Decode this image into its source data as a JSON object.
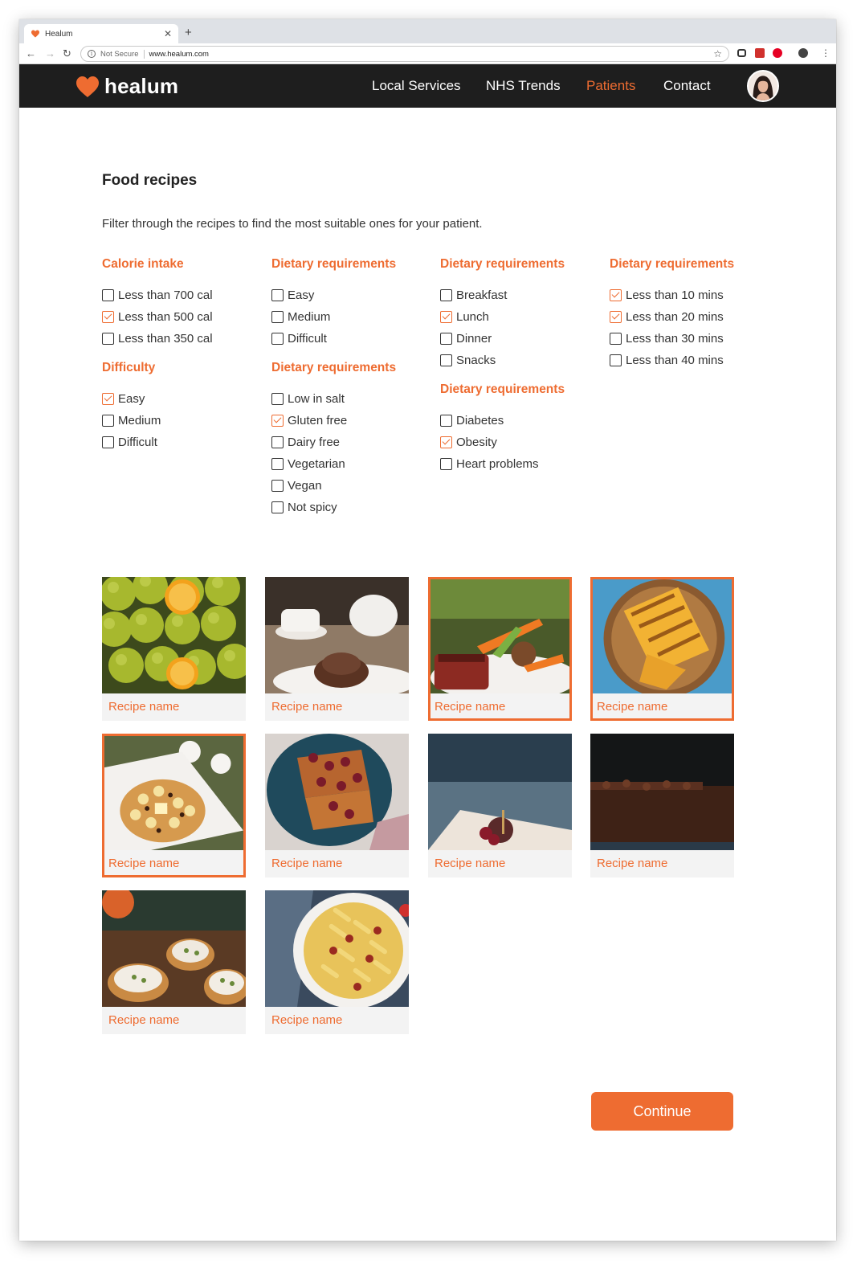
{
  "browser": {
    "tab_title": "Healum",
    "not_secure": "Not Secure",
    "url": "www.healum.com"
  },
  "site": {
    "brand": "healum",
    "nav": [
      "Local Services",
      "NHS Trends",
      "Patients",
      "Contact"
    ],
    "active_nav": "Patients"
  },
  "page": {
    "title": "Food recipes",
    "description": "Filter through the recipes to find the most suitable ones for your patient."
  },
  "filters": {
    "col1": [
      {
        "title": "Calorie intake",
        "options": [
          {
            "label": "Less than 700 cal",
            "checked": false
          },
          {
            "label": "Less than 500 cal",
            "checked": true
          },
          {
            "label": "Less than 350 cal",
            "checked": false
          }
        ]
      },
      {
        "title": "Difficulty",
        "options": [
          {
            "label": "Easy",
            "checked": true
          },
          {
            "label": "Medium",
            "checked": false
          },
          {
            "label": "Difficult",
            "checked": false
          }
        ]
      }
    ],
    "col2": [
      {
        "title": "Dietary requirements",
        "options": [
          {
            "label": "Easy",
            "checked": false
          },
          {
            "label": "Medium",
            "checked": false
          },
          {
            "label": "Difficult",
            "checked": false
          }
        ]
      },
      {
        "title": "Dietary requirements",
        "options": [
          {
            "label": "Low in salt",
            "checked": false
          },
          {
            "label": "Gluten free",
            "checked": true
          },
          {
            "label": "Dairy free",
            "checked": false
          },
          {
            "label": "Vegetarian",
            "checked": false
          },
          {
            "label": "Vegan",
            "checked": false
          },
          {
            "label": "Not spicy",
            "checked": false
          }
        ]
      }
    ],
    "col3": [
      {
        "title": "Dietary requirements",
        "options": [
          {
            "label": "Breakfast",
            "checked": false
          },
          {
            "label": "Lunch",
            "checked": true
          },
          {
            "label": "Dinner",
            "checked": false
          },
          {
            "label": "Snacks",
            "checked": false
          }
        ]
      },
      {
        "title": "Dietary requirements",
        "options": [
          {
            "label": "Diabetes",
            "checked": false
          },
          {
            "label": "Obesity",
            "checked": true
          },
          {
            "label": "Heart problems",
            "checked": false
          }
        ]
      }
    ],
    "col4": [
      {
        "title": "Dietary requirements",
        "options": [
          {
            "label": "Less than 10 mins",
            "checked": true
          },
          {
            "label": "Less than 20 mins",
            "checked": true
          },
          {
            "label": "Less than 30 mins",
            "checked": false
          },
          {
            "label": "Less than 40 mins",
            "checked": false
          }
        ]
      }
    ]
  },
  "recipes": [
    {
      "name": "Recipe name",
      "image": "citrus-fruits-photo",
      "selected": false
    },
    {
      "name": "Recipe name",
      "image": "chocolate-pudding-tea-photo",
      "selected": false
    },
    {
      "name": "Recipe name",
      "image": "steak-vegetables-photo",
      "selected": true
    },
    {
      "name": "Recipe name",
      "image": "grilled-sandwich-photo",
      "selected": true
    },
    {
      "name": "Recipe name",
      "image": "pancakes-banana-photo",
      "selected": true
    },
    {
      "name": "Recipe name",
      "image": "french-toast-berries-photo",
      "selected": false
    },
    {
      "name": "Recipe name",
      "image": "cheese-figs-snack-photo",
      "selected": false
    },
    {
      "name": "Recipe name",
      "image": "brownie-slice-photo",
      "selected": false
    },
    {
      "name": "Recipe name",
      "image": "fruit-tarts-photo",
      "selected": false
    },
    {
      "name": "Recipe name",
      "image": "pasta-dish-photo",
      "selected": false
    }
  ],
  "actions": {
    "continue_label": "Continue"
  },
  "colors": {
    "accent": "#ee6c31",
    "header_bg": "#1e1e1e"
  }
}
